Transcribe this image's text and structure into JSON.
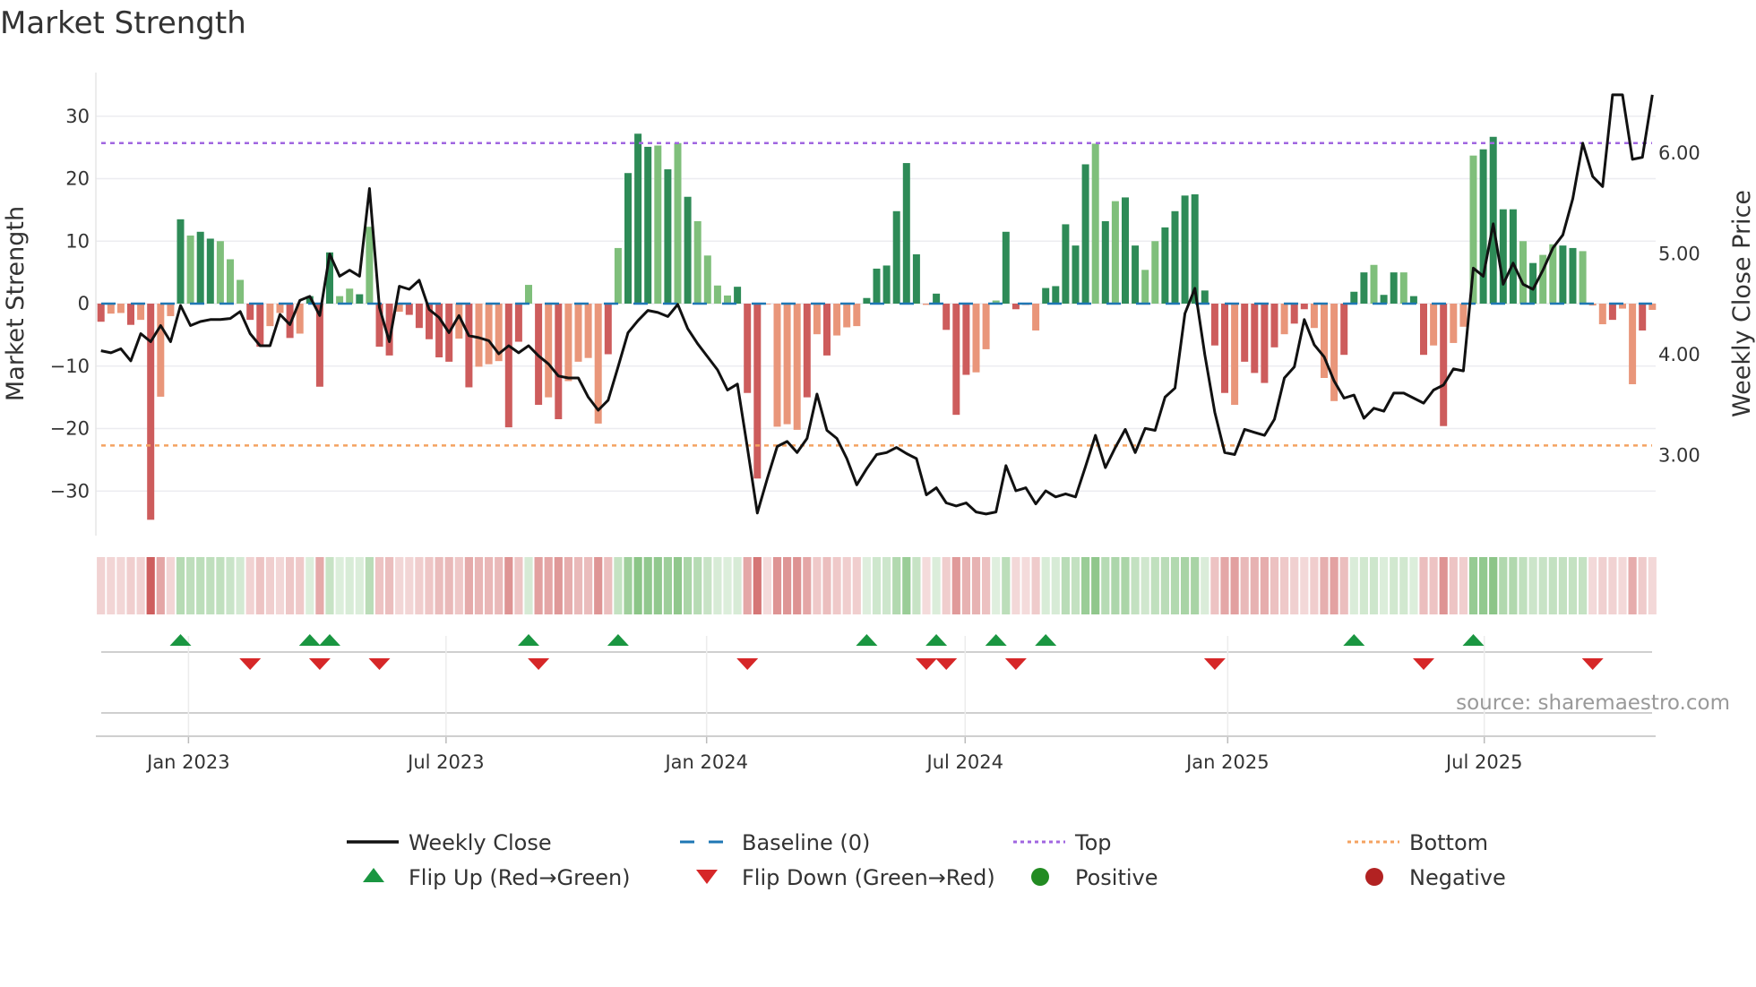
{
  "chart_data": {
    "type": "bar",
    "title": "Market Strength",
    "ylabel": "Market Strength",
    "y2label": "Weekly Close Price",
    "ylim": [
      -37,
      37
    ],
    "y2lim": [
      2.2,
      6.79
    ],
    "left_ticks": [
      {
        "v": 30,
        "label": "30"
      },
      {
        "v": 20,
        "label": "20"
      },
      {
        "v": 10,
        "label": "10"
      },
      {
        "v": 0,
        "label": "0"
      },
      {
        "v": -10,
        "label": "−10"
      },
      {
        "v": -20,
        "label": "−20"
      },
      {
        "v": -30,
        "label": "−30"
      }
    ],
    "right_ticks": [
      {
        "v": 6,
        "label": "6.00"
      },
      {
        "v": 5,
        "label": "5.00"
      },
      {
        "v": 4,
        "label": "4.00"
      },
      {
        "v": 3,
        "label": "3.00"
      }
    ],
    "x_ticks": [
      {
        "week": 9.8,
        "label": "Jan 2023"
      },
      {
        "week": 35.7,
        "label": "Jul 2023"
      },
      {
        "week": 61.9,
        "label": "Jan 2024"
      },
      {
        "week": 87.9,
        "label": "Jul 2024"
      },
      {
        "week": 114.3,
        "label": "Jan 2025"
      },
      {
        "week": 140.1,
        "label": "Jul 2025"
      }
    ],
    "top_level": 25.7,
    "bottom_level": -22.7,
    "baseline": 0,
    "strength": [
      -2.9,
      -1.6,
      -1.5,
      -3.4,
      -2.6,
      -34.6,
      -14.9,
      -2,
      13.5,
      10.9,
      11.5,
      10.4,
      10,
      7.1,
      3.8,
      -2.6,
      -6.9,
      -3.6,
      -1.5,
      -5.5,
      -4.8,
      1.2,
      -13.3,
      8.2,
      1.2,
      2.4,
      1.5,
      12.3,
      -6.9,
      -8.3,
      -1.3,
      -1.8,
      -3.9,
      -5.7,
      -8.6,
      -9.3,
      -5.6,
      -13.4,
      -10.1,
      -9.7,
      -9.2,
      -19.8,
      -6.1,
      3,
      -16.2,
      -15,
      -18.5,
      -12.4,
      -9.3,
      -8.7,
      -19.2,
      -8.1,
      8.9,
      20.9,
      27.2,
      25.1,
      25.3,
      21.5,
      25.7,
      17.1,
      13.2,
      7.7,
      2.9,
      1.3,
      2.7,
      -14.3,
      -28,
      -0.1,
      -19.7,
      -19.3,
      -20.2,
      -15,
      -4.9,
      -8.3,
      -5.1,
      -3.8,
      -3.6,
      0.9,
      5.6,
      6.1,
      14.8,
      22.5,
      7.9,
      -0.2,
      1.6,
      -4.2,
      -17.8,
      -11.4,
      -11,
      -7.3,
      0.5,
      11.5,
      -0.9,
      -0.2,
      -4.3,
      2.5,
      2.8,
      12.7,
      9.3,
      22.3,
      25.6,
      13.2,
      16.4,
      17,
      9.3,
      5.4,
      10,
      12.2,
      14.8,
      17.3,
      17.5,
      2.1,
      -6.7,
      -14.3,
      -16.2,
      -9.3,
      -11.1,
      -12.7,
      -7,
      -4.9,
      -3.2,
      -0.9,
      -3.9,
      -11.9,
      -15.6,
      -8.2,
      1.9,
      5,
      6.2,
      1.4,
      5,
      5,
      1.2,
      -8.2,
      -6.7,
      -19.6,
      -6.3,
      -3.7,
      23.7,
      24.7,
      26.7,
      15.1,
      15.1,
      10,
      6.5,
      7.8,
      9.5,
      9.3,
      8.9,
      8.4,
      -0.3,
      -3.3,
      -2.6,
      -0.8,
      -12.9,
      -4.3,
      -1
    ],
    "shade": "dlldldlldlddlllddlldldddlldlddldddddldlllddldldlllldldddldldlllldddlllldldlllddddddlddddllldddldddddldlddlldddddddlddddlddllldddlddlddldlllddddldllddllldlldllddlll",
    "weekly_close": [
      4.03,
      4.01,
      4.05,
      3.93,
      4.2,
      4.12,
      4.28,
      4.12,
      4.48,
      4.28,
      4.32,
      4.34,
      4.34,
      4.35,
      4.42,
      4.2,
      4.08,
      4.08,
      4.39,
      4.29,
      4.53,
      4.57,
      4.38,
      4.99,
      4.77,
      4.83,
      4.77,
      5.64,
      4.46,
      4.12,
      4.67,
      4.64,
      4.73,
      4.44,
      4.36,
      4.21,
      4.38,
      4.18,
      4.16,
      4.13,
      4.0,
      4.08,
      4.01,
      4.08,
      3.98,
      3.9,
      3.78,
      3.76,
      3.76,
      3.57,
      3.44,
      3.54,
      3.87,
      4.21,
      4.33,
      4.43,
      4.41,
      4.37,
      4.49,
      4.25,
      4.1,
      3.97,
      3.84,
      3.64,
      3.7,
      3.07,
      2.42,
      2.76,
      3.08,
      3.13,
      3.02,
      3.16,
      3.6,
      3.24,
      3.16,
      2.96,
      2.7,
      2.86,
      3.0,
      3.02,
      3.07,
      3.01,
      2.96,
      2.6,
      2.67,
      2.52,
      2.49,
      2.52,
      2.43,
      2.41,
      2.43,
      2.89,
      2.64,
      2.67,
      2.51,
      2.64,
      2.58,
      2.61,
      2.58,
      2.88,
      3.19,
      2.87,
      3.07,
      3.25,
      3.02,
      3.26,
      3.24,
      3.57,
      3.66,
      4.4,
      4.65,
      3.99,
      3.42,
      3.02,
      3.0,
      3.25,
      3.22,
      3.19,
      3.35,
      3.76,
      3.87,
      4.34,
      4.09,
      3.97,
      3.73,
      3.56,
      3.59,
      3.36,
      3.46,
      3.43,
      3.61,
      3.61,
      3.56,
      3.51,
      3.64,
      3.69,
      3.85,
      3.83,
      4.85,
      4.77,
      5.29,
      4.69,
      4.9,
      4.69,
      4.64,
      4.83,
      5.05,
      5.18,
      5.54,
      6.09,
      5.76,
      5.66,
      6.57,
      6.57,
      5.93,
      5.95,
      6.57
    ],
    "flip_up_weeks": [
      9,
      22,
      24,
      44,
      53,
      78,
      85,
      91,
      96,
      127,
      139
    ],
    "flip_down_weeks": [
      16,
      23,
      29,
      45,
      66,
      84,
      86,
      93,
      113,
      134,
      151
    ],
    "legend": [
      {
        "key": "close",
        "label": "Weekly Close"
      },
      {
        "key": "baseline",
        "label": "Baseline (0)"
      },
      {
        "key": "top",
        "label": "Top"
      },
      {
        "key": "bottom",
        "label": "Bottom"
      },
      {
        "key": "flip_up",
        "label": "Flip Up (Red→Green)"
      },
      {
        "key": "flip_down",
        "label": "Flip Down (Green→Red)"
      },
      {
        "key": "positive",
        "label": "Positive"
      },
      {
        "key": "negative",
        "label": "Negative"
      }
    ],
    "legend_placement": "bottom",
    "source": "source: sharemaestro.com",
    "colors": {
      "pos_strong": "#2e8b57",
      "pos_weak": "#7fbf7b",
      "neg_strong": "#cd5c5c",
      "neg_weak": "#e9967a",
      "close": "#111111",
      "baseline": "#1f77b4",
      "top": "#a066e0",
      "bottom": "#f4a261",
      "flip_up": "#1a9641",
      "flip_down": "#d62728",
      "positive": "#228b22",
      "negative": "#b22222"
    }
  }
}
